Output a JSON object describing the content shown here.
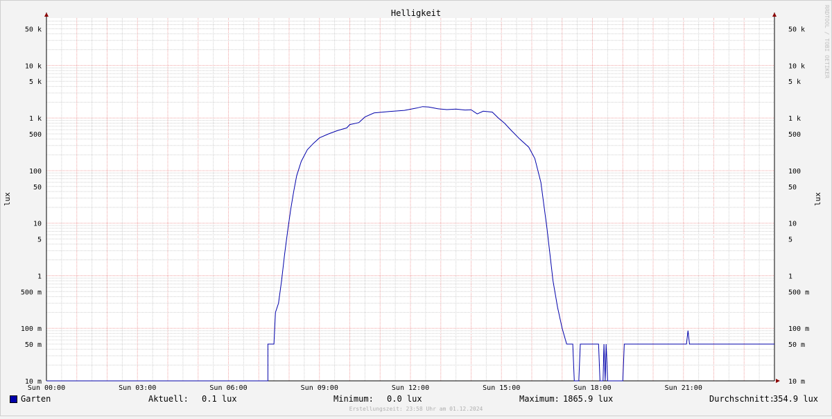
{
  "chart_data": {
    "type": "line",
    "title": "Helligkeit",
    "ylabel": "lux",
    "watermark": "RRDTOOL / TOBI OETIKER",
    "yscale": "log",
    "ylim": [
      0.01,
      80000
    ],
    "y_ticks": [
      {
        "value": 50000,
        "label": "50 k"
      },
      {
        "value": 10000,
        "label": "10 k"
      },
      {
        "value": 5000,
        "label": "5 k"
      },
      {
        "value": 1000,
        "label": "1 k"
      },
      {
        "value": 500,
        "label": "500"
      },
      {
        "value": 100,
        "label": "100"
      },
      {
        "value": 50,
        "label": "50"
      },
      {
        "value": 10,
        "label": "10"
      },
      {
        "value": 5,
        "label": "5"
      },
      {
        "value": 1,
        "label": "1"
      },
      {
        "value": 0.5,
        "label": "500 m"
      },
      {
        "value": 0.1,
        "label": "100 m"
      },
      {
        "value": 0.05,
        "label": "50 m"
      },
      {
        "value": 0.01,
        "label": "10 m"
      }
    ],
    "x_unit": "hours since 00:00",
    "xlim": [
      0,
      24
    ],
    "x_ticks": [
      {
        "value": 0,
        "label": "Sun 00:00"
      },
      {
        "value": 3,
        "label": "Sun 03:00"
      },
      {
        "value": 6,
        "label": "Sun 06:00"
      },
      {
        "value": 9,
        "label": "Sun 09:00"
      },
      {
        "value": 12,
        "label": "Sun 12:00"
      },
      {
        "value": 15,
        "label": "Sun 15:00"
      },
      {
        "value": 18,
        "label": "Sun 18:00"
      },
      {
        "value": 21,
        "label": "Sun 21:00"
      }
    ],
    "grid": true,
    "series": [
      {
        "name": "Garten",
        "color": "#0000aa",
        "points": [
          [
            0,
            0.0
          ],
          [
            7.3,
            0.0
          ],
          [
            7.3,
            0.05
          ],
          [
            7.5,
            0.05
          ],
          [
            7.55,
            0.2
          ],
          [
            7.65,
            0.3
          ],
          [
            7.75,
            0.8
          ],
          [
            7.85,
            2.5
          ],
          [
            7.95,
            7
          ],
          [
            8.05,
            18
          ],
          [
            8.15,
            40
          ],
          [
            8.25,
            80
          ],
          [
            8.4,
            150
          ],
          [
            8.6,
            250
          ],
          [
            8.8,
            330
          ],
          [
            9.0,
            420
          ],
          [
            9.3,
            500
          ],
          [
            9.6,
            580
          ],
          [
            9.9,
            650
          ],
          [
            10.0,
            750
          ],
          [
            10.3,
            820
          ],
          [
            10.5,
            1050
          ],
          [
            10.8,
            1250
          ],
          [
            11.3,
            1330
          ],
          [
            11.8,
            1400
          ],
          [
            12.2,
            1550
          ],
          [
            12.4,
            1650
          ],
          [
            12.6,
            1620
          ],
          [
            12.9,
            1500
          ],
          [
            13.2,
            1450
          ],
          [
            13.5,
            1480
          ],
          [
            13.8,
            1420
          ],
          [
            14.0,
            1440
          ],
          [
            14.2,
            1200
          ],
          [
            14.4,
            1350
          ],
          [
            14.7,
            1300
          ],
          [
            14.9,
            1000
          ],
          [
            15.1,
            800
          ],
          [
            15.3,
            600
          ],
          [
            15.6,
            400
          ],
          [
            15.9,
            280
          ],
          [
            16.1,
            170
          ],
          [
            16.3,
            60
          ],
          [
            16.5,
            8
          ],
          [
            16.7,
            0.8
          ],
          [
            16.85,
            0.25
          ],
          [
            17.0,
            0.1
          ],
          [
            17.15,
            0.05
          ],
          [
            17.35,
            0.05
          ],
          [
            17.4,
            0.0
          ],
          [
            17.55,
            0.0
          ],
          [
            17.6,
            0.05
          ],
          [
            18.2,
            0.05
          ],
          [
            18.25,
            0.0
          ],
          [
            18.35,
            0.0
          ],
          [
            18.38,
            0.05
          ],
          [
            18.42,
            0.0
          ],
          [
            18.45,
            0.05
          ],
          [
            18.5,
            0.0
          ],
          [
            19.0,
            0.0
          ],
          [
            19.05,
            0.05
          ],
          [
            21.1,
            0.05
          ],
          [
            21.15,
            0.09
          ],
          [
            21.2,
            0.05
          ],
          [
            24,
            0.05
          ]
        ]
      }
    ]
  },
  "legend": {
    "series_name": "Garten",
    "aktuell_label": "Aktuell:",
    "aktuell_value": "0.1 lux",
    "minimum_label": "Minimum:",
    "minimum_value": "0.0 lux",
    "maximum_label": "Maximum:",
    "maximum_value": "1865.9 lux",
    "average_label": "Durchschnitt:",
    "average_value": "354.9 lux"
  },
  "footer": "Erstellungszeit: 23:58 Uhr am 01.12.2024",
  "colors": {
    "line": "#0000aa",
    "major_grid": "#f0a0a0",
    "minor_grid": "#d0d0d0",
    "arrow": "#8b0000"
  }
}
